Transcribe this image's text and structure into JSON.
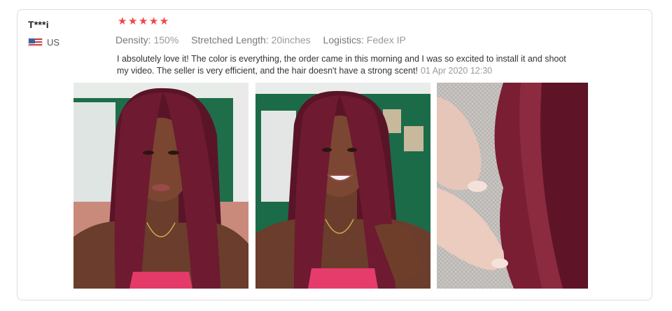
{
  "review": {
    "username": "T***i",
    "country": "US",
    "rating": 5,
    "stars": "★★★★★",
    "specs": [
      {
        "key": "Density:",
        "value": "150%"
      },
      {
        "key": "Stretched Length:",
        "value": "20inches"
      },
      {
        "key": "Logistics:",
        "value": "Fedex IP"
      }
    ],
    "text_line1": "I absolutely love it! The color is everything, the order came in this morning and I was so excited to install it and shoot",
    "text_line2": "my video. The seller is very efficient, and the hair doesn't have a strong scent!",
    "date": "01 Apr 2020 12:30"
  },
  "colors": {
    "star": "#f04848",
    "hair": "#6e1a30",
    "wall": "#1f6e4a"
  }
}
